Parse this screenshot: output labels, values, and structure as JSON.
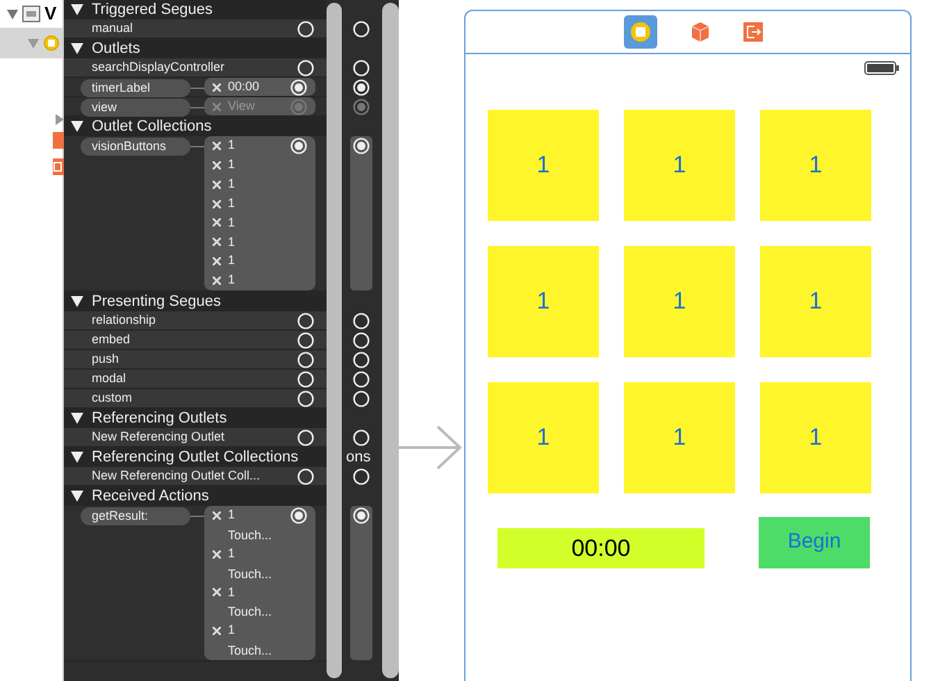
{
  "outline": {
    "title": "V"
  },
  "connections": [
    {
      "title": "Triggered Segues",
      "rows": [
        {
          "label": "manual",
          "connected": false,
          "disabled": false,
          "side_connected": false,
          "targets": []
        }
      ]
    },
    {
      "title": "Outlets",
      "rows": [
        {
          "label": "searchDisplayController",
          "connected": false,
          "disabled": false,
          "side_connected": false,
          "targets": []
        },
        {
          "label": "timerLabel",
          "connected": true,
          "disabled": false,
          "side_connected": true,
          "targets": [
            {
              "label": "00:00"
            }
          ]
        },
        {
          "label": "view",
          "connected": true,
          "disabled": true,
          "side_connected": true,
          "targets": [
            {
              "label": "View"
            }
          ]
        }
      ]
    },
    {
      "title": "Outlet Collections",
      "rows": [
        {
          "label": "visionButtons",
          "connected": true,
          "disabled": false,
          "side_connected": true,
          "targets": [
            {
              "label": "1"
            },
            {
              "label": "1"
            },
            {
              "label": "1"
            },
            {
              "label": "1"
            },
            {
              "label": "1"
            },
            {
              "label": "1"
            },
            {
              "label": "1"
            },
            {
              "label": "1"
            }
          ]
        }
      ]
    },
    {
      "title": "Presenting Segues",
      "rows": [
        {
          "label": "relationship",
          "connected": false,
          "disabled": false,
          "side_connected": false,
          "targets": []
        },
        {
          "label": "embed",
          "connected": false,
          "disabled": false,
          "side_connected": false,
          "targets": []
        },
        {
          "label": "push",
          "connected": false,
          "disabled": false,
          "side_connected": false,
          "targets": []
        },
        {
          "label": "modal",
          "connected": false,
          "disabled": false,
          "side_connected": false,
          "targets": []
        },
        {
          "label": "custom",
          "connected": false,
          "disabled": false,
          "side_connected": false,
          "targets": []
        }
      ]
    },
    {
      "title": "Referencing Outlets",
      "rows": [
        {
          "label": "New Referencing Outlet",
          "connected": false,
          "disabled": false,
          "side_connected": false,
          "targets": []
        }
      ]
    },
    {
      "title": "Referencing Outlet Collections",
      "side_text": "ons",
      "rows": [
        {
          "label": "New Referencing Outlet Coll...",
          "connected": false,
          "disabled": false,
          "side_connected": false,
          "targets": []
        }
      ]
    },
    {
      "title": "Received Actions",
      "rows": [
        {
          "label": "getResult:",
          "connected": true,
          "disabled": false,
          "side_connected": true,
          "targets": [
            {
              "label": "1",
              "detail": "Touch..."
            },
            {
              "label": "1",
              "detail": "Touch..."
            },
            {
              "label": "1",
              "detail": "Touch..."
            },
            {
              "label": "1",
              "detail": "Touch..."
            }
          ]
        }
      ]
    }
  ],
  "scene": {
    "grid_buttons": [
      "1",
      "1",
      "1",
      "1",
      "1",
      "1",
      "1",
      "1",
      "1"
    ],
    "timer_label": "00:00",
    "begin_button": "Begin"
  }
}
